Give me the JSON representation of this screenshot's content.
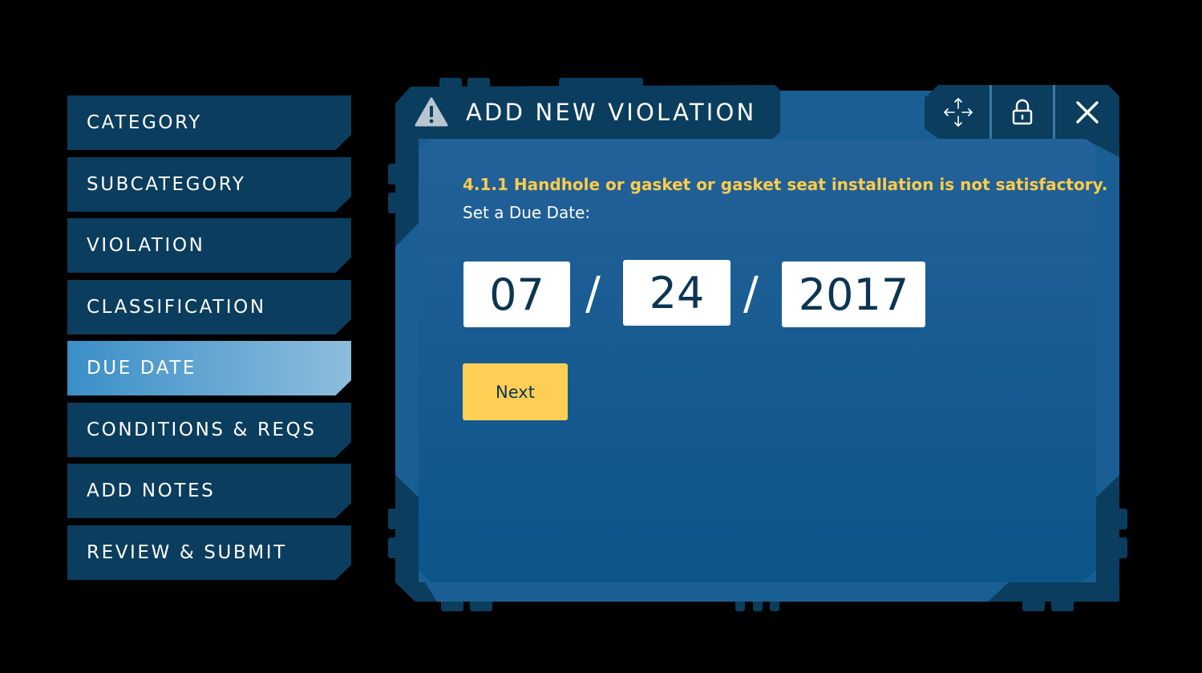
{
  "sidebar": {
    "items": [
      {
        "label": "CATEGORY",
        "active": false
      },
      {
        "label": "SUBCATEGORY",
        "active": false
      },
      {
        "label": "VIOLATION",
        "active": false
      },
      {
        "label": "CLASSIFICATION",
        "active": false
      },
      {
        "label": "DUE DATE",
        "active": true
      },
      {
        "label": "CONDITIONS & REQS",
        "active": false
      },
      {
        "label": "ADD NOTES",
        "active": false
      },
      {
        "label": "REVIEW & SUBMIT",
        "active": false
      }
    ]
  },
  "dialog": {
    "title": "ADD NEW VIOLATION",
    "title_icon": "warning-icon",
    "toolbar_icons": [
      "move-icon",
      "lock-icon",
      "close-icon"
    ],
    "violation_text": "4.1.1 Handhole or gasket or gasket seat installation is not satisfactory.",
    "due_date_label": "Set a Due Date:",
    "date": {
      "month": "07",
      "day": "24",
      "year": "2017",
      "separator": "/"
    },
    "next_label": "Next"
  },
  "colors": {
    "background": "#000000",
    "sidebar_item": "#0b3d5e",
    "sidebar_active_start": "#3a8fc8",
    "sidebar_active_end": "#8ebddc",
    "frame": "#0b3d5e",
    "panel_top": "#236199",
    "panel_bottom": "#0b5589",
    "accent_yellow": "#ffcf55",
    "dark_text": "#0b3553"
  }
}
